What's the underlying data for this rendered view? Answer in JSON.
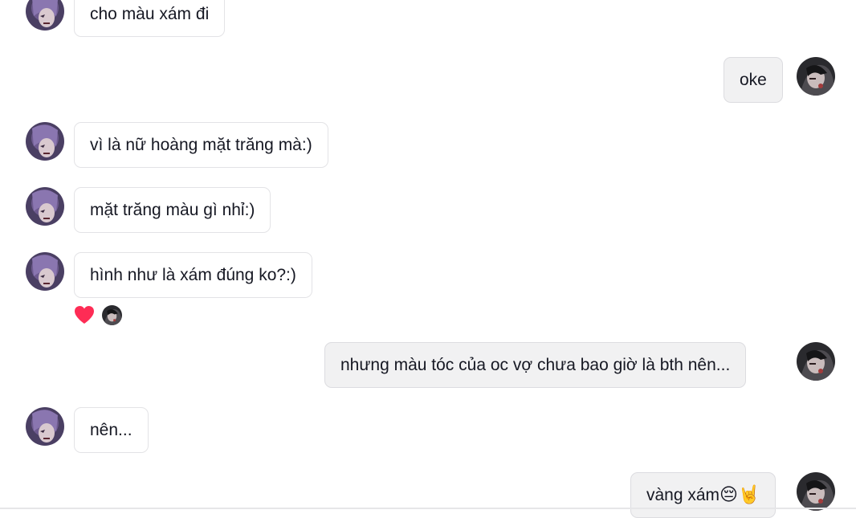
{
  "conversation": {
    "messages": [
      {
        "sender": "other",
        "text": "cho màu xám đi"
      },
      {
        "sender": "me",
        "text": "oke"
      },
      {
        "sender": "other",
        "text": "vì là nữ hoàng mặt trăng mà:)"
      },
      {
        "sender": "other",
        "text": "mặt trăng màu gì nhỉ:)"
      },
      {
        "sender": "other",
        "text": "hình như là xám đúng ko?:)",
        "reactions": [
          "heart-icon"
        ]
      },
      {
        "sender": "me",
        "text": "nhưng màu tóc của oc vợ chưa bao giờ là bth nên..."
      },
      {
        "sender": "other",
        "text": "nên..."
      },
      {
        "sender": "me",
        "text": "vàng xám",
        "emojis": [
          "😔",
          "🤘"
        ]
      }
    ]
  },
  "colors": {
    "incoming_bubble": "#ffffff",
    "outgoing_bubble": "#f1f1f2",
    "reaction_heart": "#fe2c55",
    "text": "#161823"
  }
}
